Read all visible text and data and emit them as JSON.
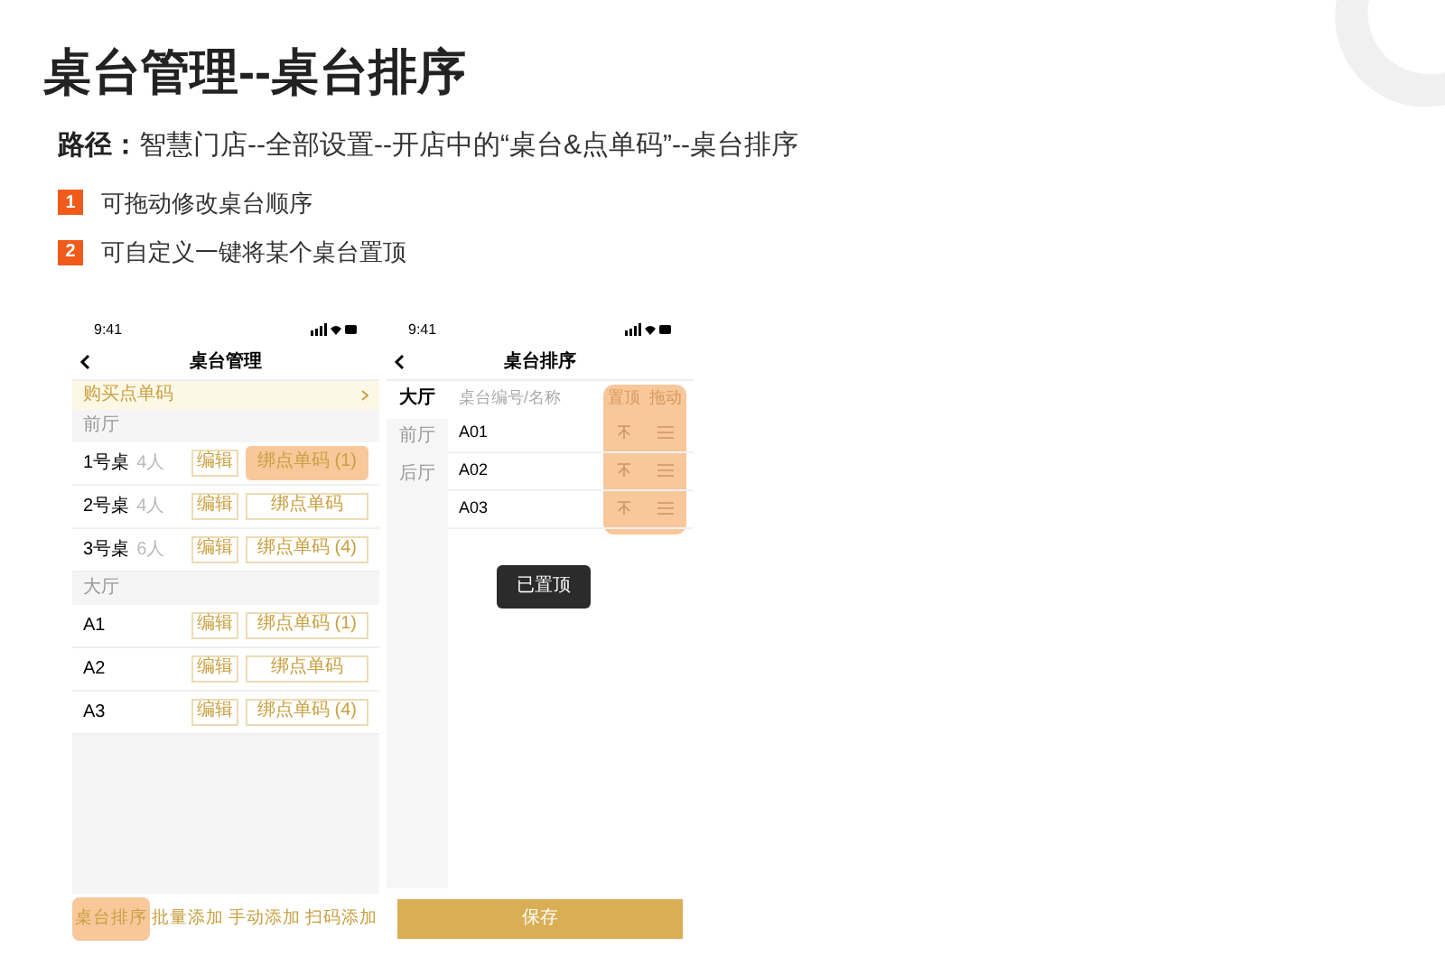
{
  "title": "桌台管理--桌台排序",
  "path": {
    "label": "路径：",
    "text": "智慧门店--全部设置--开店中的“桌台&点单码”--桌台排序"
  },
  "steps": [
    {
      "number": "1",
      "text": "可拖动修改桌台顺序"
    },
    {
      "number": "2",
      "text": "可自定义一键将某个桌台置顶"
    }
  ],
  "left_phone": {
    "time": "9:41",
    "title": "桌台管理",
    "banner": "购买点单码",
    "sections": [
      {
        "name": "前厅",
        "tables": [
          {
            "name": "1号桌",
            "seats": "4人",
            "edit": "编辑",
            "code": "绑点单码 (1)",
            "highlighted": true
          },
          {
            "name": "2号桌",
            "seats": "4人",
            "edit": "编辑",
            "code": "绑点单码",
            "highlighted": false
          },
          {
            "name": "3号桌",
            "seats": "6人",
            "edit": "编辑",
            "code": "绑点单码 (4)",
            "highlighted": false
          }
        ]
      },
      {
        "name": "大厅",
        "tables": [
          {
            "name": "A1",
            "edit": "编辑",
            "code": "绑点单码 (1)",
            "highlighted": false
          },
          {
            "name": "A2",
            "edit": "编辑",
            "code": "绑点单码",
            "highlighted": false
          },
          {
            "name": "A3",
            "edit": "编辑",
            "code": "绑点单码 (4)",
            "highlighted": false
          }
        ]
      }
    ],
    "tabs": [
      {
        "label": "桌台排序",
        "highlighted": true
      },
      {
        "label": "批量添加",
        "highlighted": false
      },
      {
        "label": "手动添加",
        "highlighted": false
      },
      {
        "label": "扫码添加",
        "highlighted": false
      }
    ]
  },
  "right_phone": {
    "time": "9:41",
    "title": "桌台排序",
    "areas": [
      {
        "label": "大厅",
        "selected": true
      },
      {
        "label": "前厅",
        "selected": false
      },
      {
        "label": "后厅",
        "selected": false
      }
    ],
    "columns": {
      "name": "桌台编号/名称",
      "pin": "置顶",
      "drag": "拖动"
    },
    "actions_highlighted": true,
    "rows": [
      {
        "name": "A01"
      },
      {
        "name": "A02"
      },
      {
        "name": "A03"
      }
    ],
    "toast": "已置顶",
    "save": "保存"
  }
}
